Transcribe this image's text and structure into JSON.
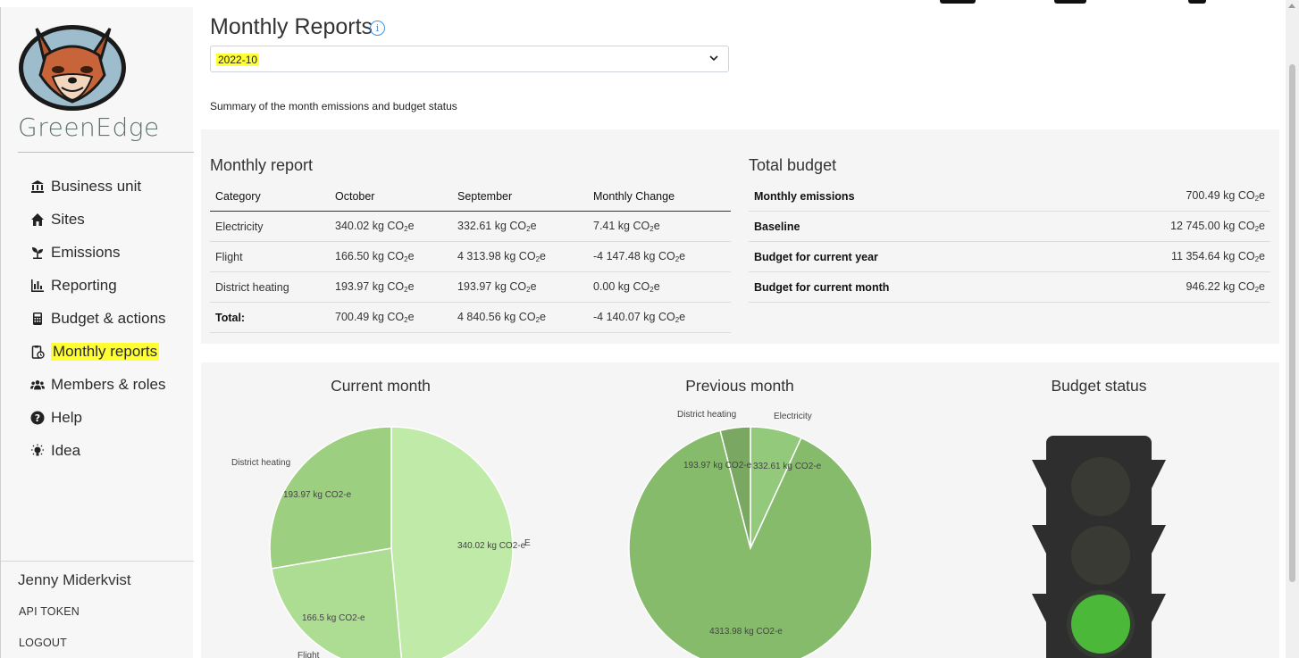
{
  "sidebar": {
    "brand": "GreenEdge",
    "items": [
      {
        "label": "Business unit",
        "icon": "bank-icon"
      },
      {
        "label": "Sites",
        "icon": "home-icon"
      },
      {
        "label": "Emissions",
        "icon": "seedling-icon"
      },
      {
        "label": "Reporting",
        "icon": "bar-chart-icon"
      },
      {
        "label": "Budget & actions",
        "icon": "calculator-icon"
      },
      {
        "label": "Monthly reports",
        "icon": "clipboard-clock-icon",
        "active": true
      },
      {
        "label": "Members & roles",
        "icon": "users-icon"
      },
      {
        "label": "Help",
        "icon": "question-circle-icon"
      },
      {
        "label": "Idea",
        "icon": "lightbulb-icon"
      }
    ],
    "user_name": "Jenny Miderkvist",
    "api_token": "API TOKEN",
    "logout": "LOGOUT"
  },
  "main": {
    "title": "Monthly Reports",
    "month_select": {
      "value": "2022-10"
    },
    "summary": "Summary of the month emissions and budget status",
    "monthly_report": {
      "title": "Monthly report",
      "columns": [
        "Category",
        "October",
        "September",
        "Monthly Change"
      ],
      "rows": [
        [
          "Electricity",
          "340.02 kg CO",
          "332.61 kg CO",
          "7.41 kg CO"
        ],
        [
          "Flight",
          "166.50 kg CO",
          "4 313.98 kg CO",
          "-4 147.48 kg CO"
        ],
        [
          "District heating",
          "193.97 kg CO",
          "193.97 kg CO",
          "0.00 kg CO"
        ]
      ],
      "total": [
        "Total:",
        "700.49 kg CO",
        "4 840.56 kg CO",
        "-4 140.07 kg CO"
      ],
      "unit_sub": "2",
      "unit_suffix": "e"
    },
    "total_budget": {
      "title": "Total budget",
      "rows": [
        {
          "label": "Monthly emissions",
          "value": "700.49 kg CO"
        },
        {
          "label": "Baseline",
          "value": "12 745.00 kg CO"
        },
        {
          "label": "Budget for current year",
          "value": "11 354.64 kg CO"
        },
        {
          "label": "Budget for current month",
          "value": "946.22 kg CO"
        }
      ]
    },
    "charts_titles": {
      "current": "Current month",
      "previous": "Previous month",
      "budget": "Budget status"
    }
  },
  "chart_data": [
    {
      "type": "pie",
      "title": "Current month",
      "categories": [
        "Electricity",
        "Flight",
        "District heating"
      ],
      "values": [
        340.02,
        166.5,
        193.97
      ],
      "value_labels": [
        "340.02 kg CO2-e",
        "166.5 kg CO2-e",
        "193.97 kg CO2-e"
      ],
      "category_labels": [
        "E",
        "Flight",
        "District heating"
      ],
      "colors": [
        "#bfeaa7",
        "#addd92",
        "#9ccf80"
      ]
    },
    {
      "type": "pie",
      "title": "Previous month",
      "categories": [
        "Electricity",
        "Flight",
        "District heating"
      ],
      "values": [
        332.61,
        4313.98,
        193.97
      ],
      "value_labels": [
        "332.61 kg CO2-e",
        "4313.98 kg CO2-e",
        "193.97 kg CO2-e"
      ],
      "category_labels": [
        "Electricity",
        "",
        "District heating"
      ],
      "colors": [
        "#93c97a",
        "#86bb6c",
        "#7aa862"
      ]
    }
  ],
  "budget_status": {
    "active_light": "green",
    "colors": {
      "on": "#4bb83a",
      "off": "#3a3a35",
      "housing": "#2e2e2e"
    }
  }
}
